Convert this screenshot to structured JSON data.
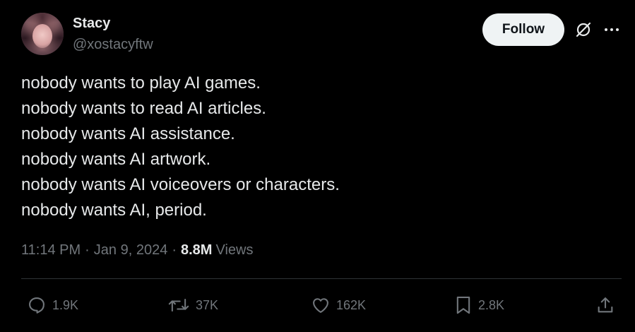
{
  "author": {
    "name": "Stacy",
    "handle": "@xostacyftw"
  },
  "header": {
    "follow_label": "Follow",
    "icons": [
      "grok-icon",
      "more-icon"
    ]
  },
  "tweet": {
    "lines": [
      "nobody wants to play AI games.",
      "nobody wants to read AI articles.",
      "nobody wants AI assistance.",
      "nobody wants AI artwork.",
      "nobody wants AI voiceovers or characters.",
      "nobody wants AI, period."
    ]
  },
  "meta": {
    "time": "11:14 PM",
    "separator": "·",
    "date": "Jan 9, 2024",
    "views_count": "8.8M",
    "views_label": "Views"
  },
  "actions": {
    "replies": "1.9K",
    "reposts": "37K",
    "likes": "162K",
    "bookmarks": "2.8K"
  },
  "colors": {
    "background": "#000000",
    "text": "#e7e9ea",
    "muted": "#71767b",
    "divider": "#2f3336",
    "follow_bg": "#eff3f4"
  }
}
